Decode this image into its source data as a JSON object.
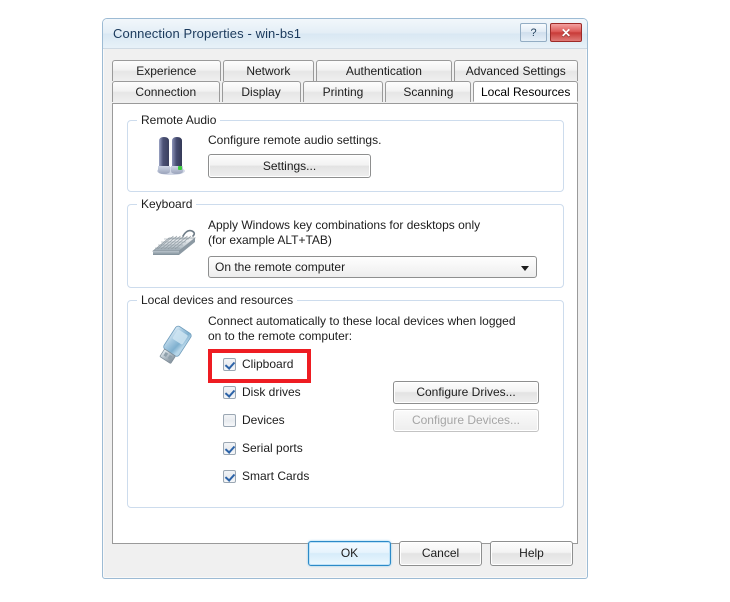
{
  "window": {
    "title": "Connection Properties - win-bs1",
    "help_button": "?",
    "close_button": "✕",
    "help_icon_name": "help-icon",
    "close_icon_name": "close-icon"
  },
  "tabs": {
    "row1": [
      {
        "label": "Experience",
        "active": false
      },
      {
        "label": "Network",
        "active": false
      },
      {
        "label": "Authentication",
        "active": false
      },
      {
        "label": "Advanced Settings",
        "active": false
      }
    ],
    "row2": [
      {
        "label": "Connection",
        "active": false
      },
      {
        "label": "Display",
        "active": false
      },
      {
        "label": "Printing",
        "active": false
      },
      {
        "label": "Scanning",
        "active": false
      },
      {
        "label": "Local Resources",
        "active": true
      }
    ],
    "selected": "Local Resources"
  },
  "remote_audio": {
    "legend": "Remote Audio",
    "description": "Configure remote audio settings.",
    "settings_button": "Settings...",
    "icon": "speakers-icon"
  },
  "keyboard": {
    "legend": "Keyboard",
    "description_line1": "Apply Windows key combinations for desktops only",
    "description_line2": "(for example ALT+TAB)",
    "dropdown_value": "On the remote computer",
    "icon": "keyboard-icon"
  },
  "local_devices": {
    "legend": "Local devices and resources",
    "description_line1": "Connect automatically to these local devices when logged",
    "description_line2": "on to the remote computer:",
    "icon": "usb-drive-icon",
    "checkboxes": [
      {
        "label": "Clipboard",
        "checked": true,
        "highlighted": true
      },
      {
        "label": "Disk drives",
        "checked": true,
        "highlighted": false
      },
      {
        "label": "Devices",
        "checked": false,
        "highlighted": false
      },
      {
        "label": "Serial ports",
        "checked": true,
        "highlighted": false
      },
      {
        "label": "Smart Cards",
        "checked": true,
        "highlighted": false
      }
    ],
    "configure_drives_button": "Configure Drives...",
    "configure_devices_button": "Configure Devices...",
    "configure_devices_disabled": true
  },
  "footer": {
    "ok": "OK",
    "cancel": "Cancel",
    "help": "Help",
    "default_button": "OK"
  },
  "colors": {
    "highlight": "#ee1c22",
    "title_text": "#1b3a5c",
    "close_button": "#c83b38",
    "group_border": "#cddced",
    "default_button_border": "#2c8ac8"
  }
}
